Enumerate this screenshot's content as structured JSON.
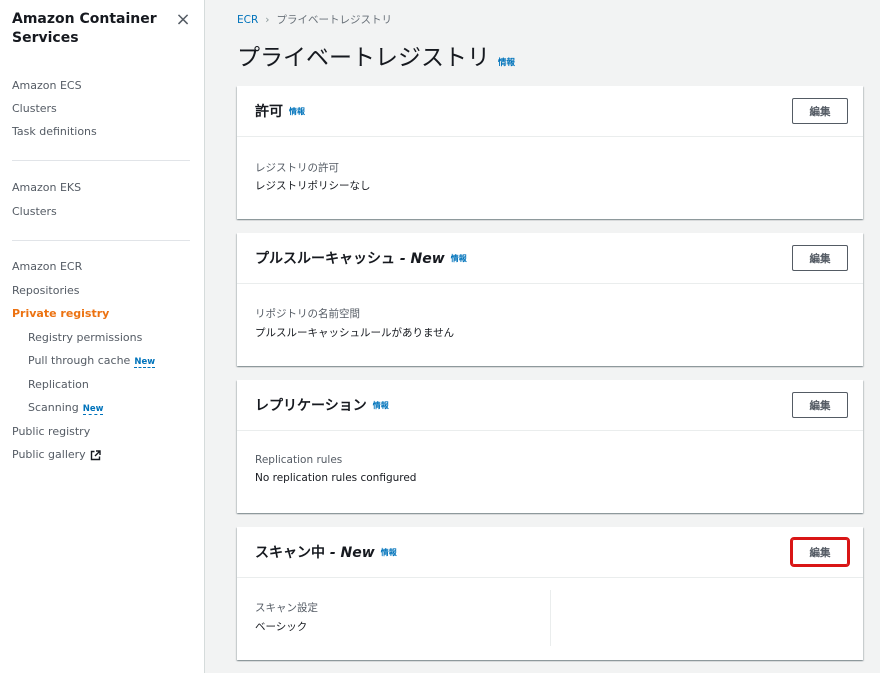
{
  "sidebar": {
    "title": "Amazon Container Services",
    "close_icon": "×",
    "sections": [
      {
        "header": "Amazon ECS",
        "items": [
          "Clusters",
          "Task definitions"
        ]
      },
      {
        "header": "Amazon EKS",
        "items": [
          "Clusters"
        ]
      },
      {
        "header": "Amazon ECR",
        "items": [
          "Repositories"
        ]
      }
    ],
    "private_registry": "Private registry",
    "sub_items": {
      "registry_permissions": "Registry permissions",
      "pull_through_cache": "Pull through cache",
      "replication": "Replication",
      "scanning": "Scanning"
    },
    "new_badge": "New",
    "public_registry": "Public registry",
    "public_gallery": "Public gallery"
  },
  "breadcrumb": {
    "root": "ECR",
    "separator": "›",
    "current": "プライベートレジストリ"
  },
  "page": {
    "title": "プライベートレジストリ",
    "info": "情報"
  },
  "panels": {
    "permissions": {
      "title": "許可",
      "info": "情報",
      "edit": "編集",
      "key": "レジストリの許可",
      "value": "レジストリポリシーなし"
    },
    "pull_through": {
      "title": "プルスルーキャッシュ",
      "new_suffix": " - New",
      "info": "情報",
      "edit": "編集",
      "key": "リポジトリの名前空間",
      "value": "プルスルーキャッシュルールがありません"
    },
    "replication": {
      "title": "レプリケーション",
      "info": "情報",
      "edit": "編集",
      "key": "Replication rules",
      "value": "No replication rules configured"
    },
    "scanning": {
      "title": "スキャン中",
      "new_suffix": " - New",
      "info": "情報",
      "edit": "編集",
      "key": "スキャン設定",
      "value": "ベーシック"
    }
  },
  "colors": {
    "accent_orange": "#ec7211",
    "link_blue": "#0073bb",
    "highlight_red": "#d91515"
  },
  "icons": [
    "close-icon",
    "chevron-right-icon",
    "external-link-icon"
  ]
}
